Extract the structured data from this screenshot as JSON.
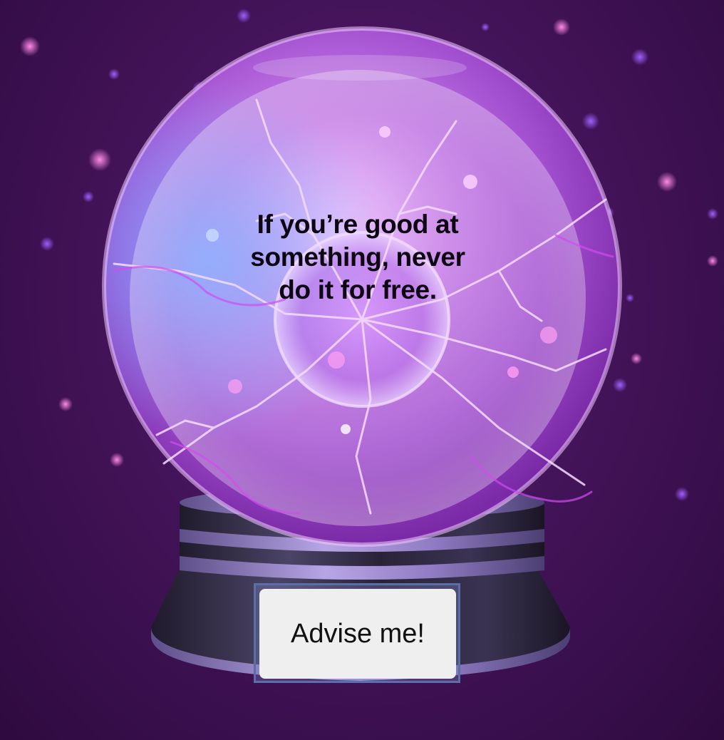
{
  "fortune": {
    "advice_text": "If you’re good at something, never do it for free."
  },
  "controls": {
    "advise_button_label": "Advise me!"
  },
  "colors": {
    "background": "#45145b",
    "globe_glow": "#c46be0",
    "plasma_core": "#e7b6ff",
    "lightning": "#f3d4ff",
    "base_dark": "#2b2438",
    "base_trim": "#8f7bc2",
    "button_face": "#efefef",
    "button_frame": "#5a6fa8"
  },
  "icons": {
    "globe": "crystal-ball-icon",
    "stars": "sparkle-icon"
  }
}
